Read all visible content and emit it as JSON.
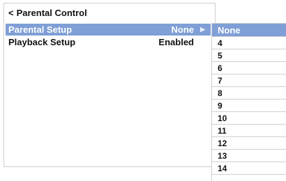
{
  "header": {
    "back_glyph": "<",
    "title": "Parental Control"
  },
  "menu": {
    "items": [
      {
        "label": "Parental Setup",
        "value": "None",
        "selected": true
      },
      {
        "label": "Playback Setup",
        "value": "Enabled",
        "selected": false
      }
    ]
  },
  "dropdown": {
    "selected_value": "None",
    "options": [
      "None",
      "4",
      "5",
      "6",
      "7",
      "8",
      "9",
      "10",
      "11",
      "12",
      "13",
      "14"
    ]
  },
  "colors": {
    "highlight": "#7f9fd6",
    "border": "#cfcfcf",
    "text": "#111111"
  },
  "icons": {
    "back": "back-chevron-icon",
    "submenu_arrow": "right-triangle-icon"
  }
}
